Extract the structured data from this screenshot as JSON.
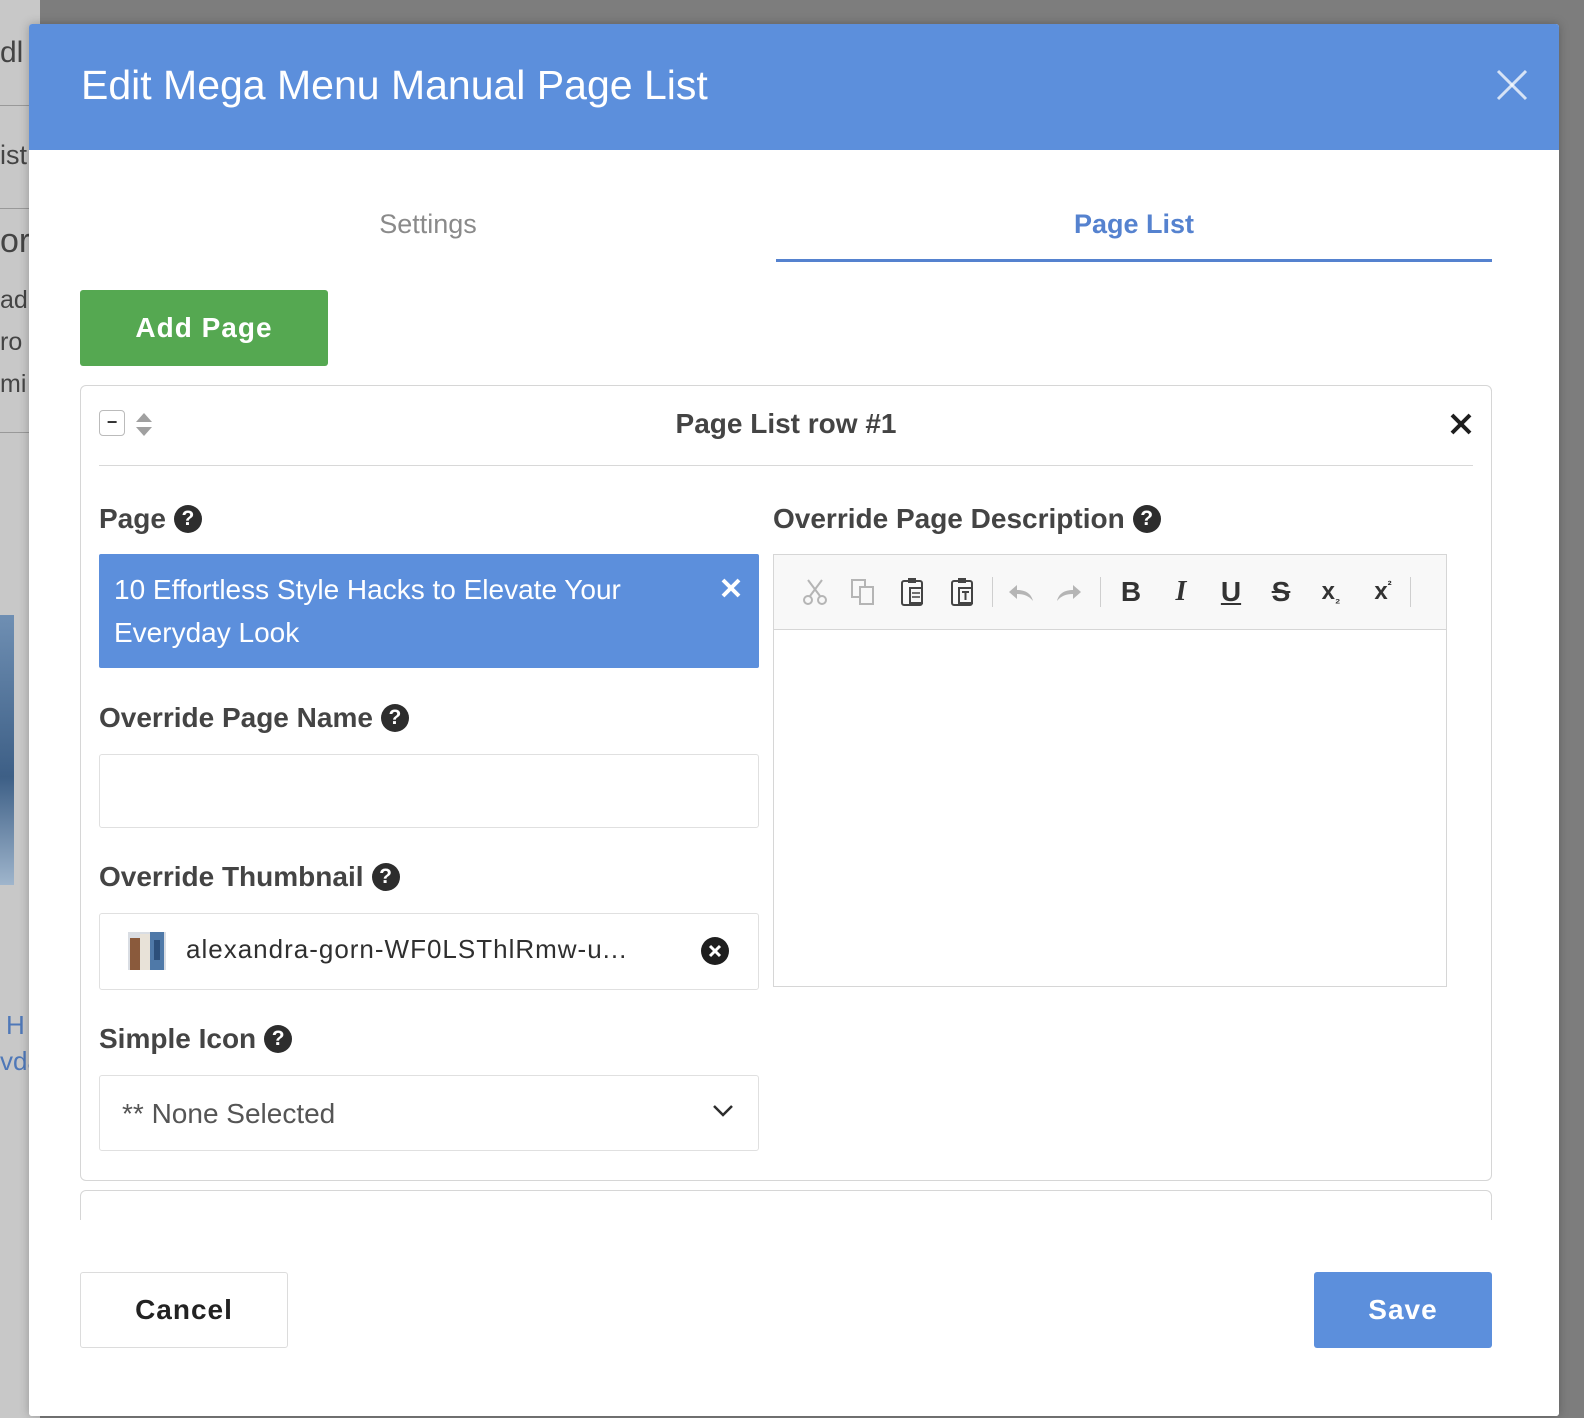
{
  "background": {
    "fragments": [
      "dl",
      "ist",
      "or",
      "ad",
      "ro",
      "mi",
      "H",
      "vda"
    ]
  },
  "modal": {
    "title": "Edit Mega Menu Manual Page List"
  },
  "tabs": [
    {
      "label": "Settings",
      "active": false
    },
    {
      "label": "Page List",
      "active": true
    }
  ],
  "add_page_label": "Add Page",
  "row": {
    "title": "Page List row #1",
    "collapse_symbol": "−",
    "page": {
      "label": "Page",
      "value": "10 Effortless Style Hacks to Elevate Your Everyday Look"
    },
    "override_name": {
      "label": "Override Page Name",
      "value": ""
    },
    "override_thumbnail": {
      "label": "Override Thumbnail",
      "filename": "alexandra-gorn-WF0LSThlRmw-u..."
    },
    "simple_icon": {
      "label": "Simple Icon",
      "selected": "** None Selected"
    },
    "override_description": {
      "label": "Override Page Description",
      "toolbar": [
        "cut-icon",
        "copy-icon",
        "paste-icon",
        "paste-text-icon",
        "undo-icon",
        "redo-icon",
        "bold",
        "italic",
        "underline",
        "strikethrough",
        "subscript",
        "superscript"
      ],
      "bold": "B",
      "italic": "I",
      "underline": "U",
      "strike": "S",
      "subscript": "x",
      "superscript": "x"
    }
  },
  "help_symbol": "?",
  "footer": {
    "cancel": "Cancel",
    "save": "Save"
  },
  "colors": {
    "primary": "#5c8fdc",
    "success": "#55a851",
    "tab_active": "#5582cf"
  }
}
